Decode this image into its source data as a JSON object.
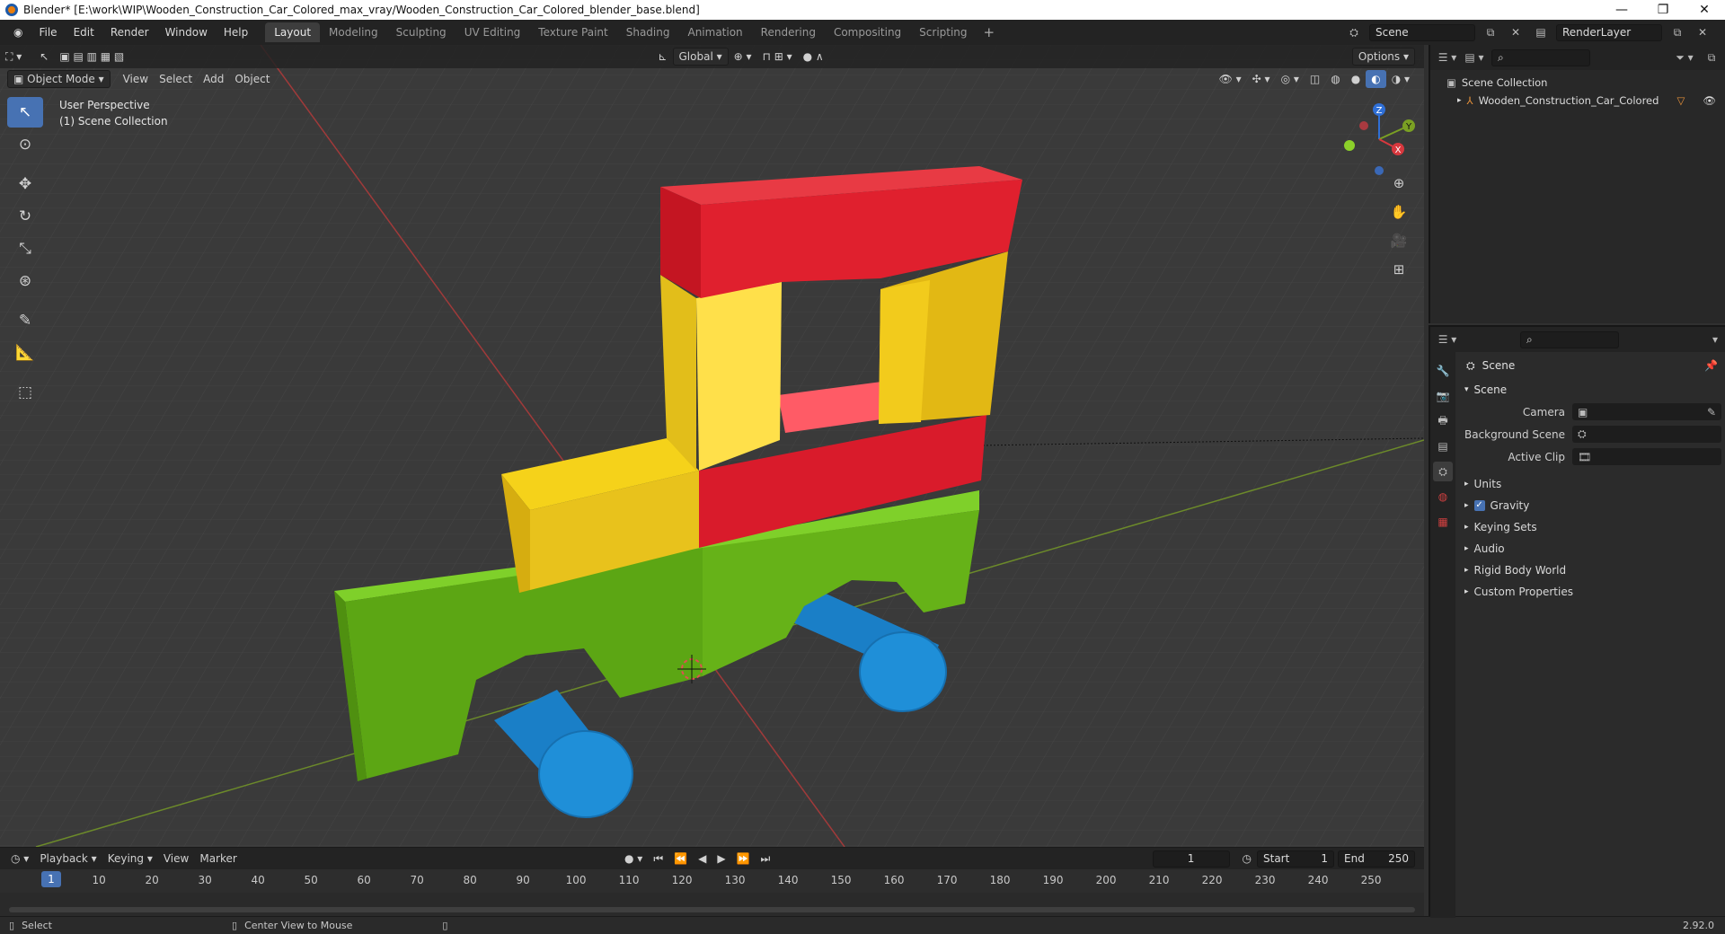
{
  "window": {
    "title": "Blender* [E:\\work\\WIP\\Wooden_Construction_Car_Colored_max_vray/Wooden_Construction_Car_Colored_blender_base.blend]",
    "controls": [
      "—",
      "❐",
      "✕"
    ]
  },
  "menu": [
    "File",
    "Edit",
    "Render",
    "Window",
    "Help"
  ],
  "workspaces": [
    {
      "label": "Layout",
      "active": true
    },
    {
      "label": "Modeling"
    },
    {
      "label": "Sculpting"
    },
    {
      "label": "UV Editing"
    },
    {
      "label": "Texture Paint"
    },
    {
      "label": "Shading"
    },
    {
      "label": "Animation"
    },
    {
      "label": "Rendering"
    },
    {
      "label": "Compositing"
    },
    {
      "label": "Scripting"
    }
  ],
  "scene_field": "Scene",
  "render_layer": "RenderLayer",
  "viewport": {
    "transform_orientation": "Global",
    "options_label": "Options",
    "mode": "Object Mode",
    "menus": [
      "View",
      "Select",
      "Add",
      "Object"
    ],
    "info_line1": "User Perspective",
    "info_line2": "(1) Scene Collection",
    "gizmo_axes": {
      "z": "Z",
      "y": "Y",
      "x": "X"
    }
  },
  "colors": {
    "red": "#d8182a",
    "yellow": "#f2c21d",
    "green": "#6ab517",
    "blue": "#1f8fd8",
    "accent": "#4772b3"
  },
  "timeline": {
    "menus": [
      "Playback",
      "Keying",
      "View",
      "Marker"
    ],
    "current_frame": "1",
    "start_label": "Start",
    "start": "1",
    "end_label": "End",
    "end": "250",
    "ticks": [
      "1",
      "10",
      "20",
      "30",
      "40",
      "50",
      "60",
      "70",
      "80",
      "90",
      "100",
      "110",
      "120",
      "130",
      "140",
      "150",
      "160",
      "170",
      "180",
      "190",
      "200",
      "210",
      "220",
      "230",
      "240",
      "250"
    ]
  },
  "status": {
    "left": "Select",
    "middle": "Center View to Mouse",
    "version": "2.92.0"
  },
  "outliner": {
    "root": "Scene Collection",
    "item": "Wooden_Construction_Car_Colored"
  },
  "properties": {
    "context_title": "Scene",
    "panel": "Scene",
    "fields": [
      {
        "label": "Camera",
        "value": ""
      },
      {
        "label": "Background Scene",
        "value": ""
      },
      {
        "label": "Active Clip",
        "value": ""
      }
    ],
    "subpanels": [
      {
        "label": "Units",
        "checkbox": false
      },
      {
        "label": "Gravity",
        "checkbox": true
      },
      {
        "label": "Keying Sets",
        "checkbox": false
      },
      {
        "label": "Audio",
        "checkbox": false
      },
      {
        "label": "Rigid Body World",
        "checkbox": false
      },
      {
        "label": "Custom Properties",
        "checkbox": false
      }
    ]
  }
}
